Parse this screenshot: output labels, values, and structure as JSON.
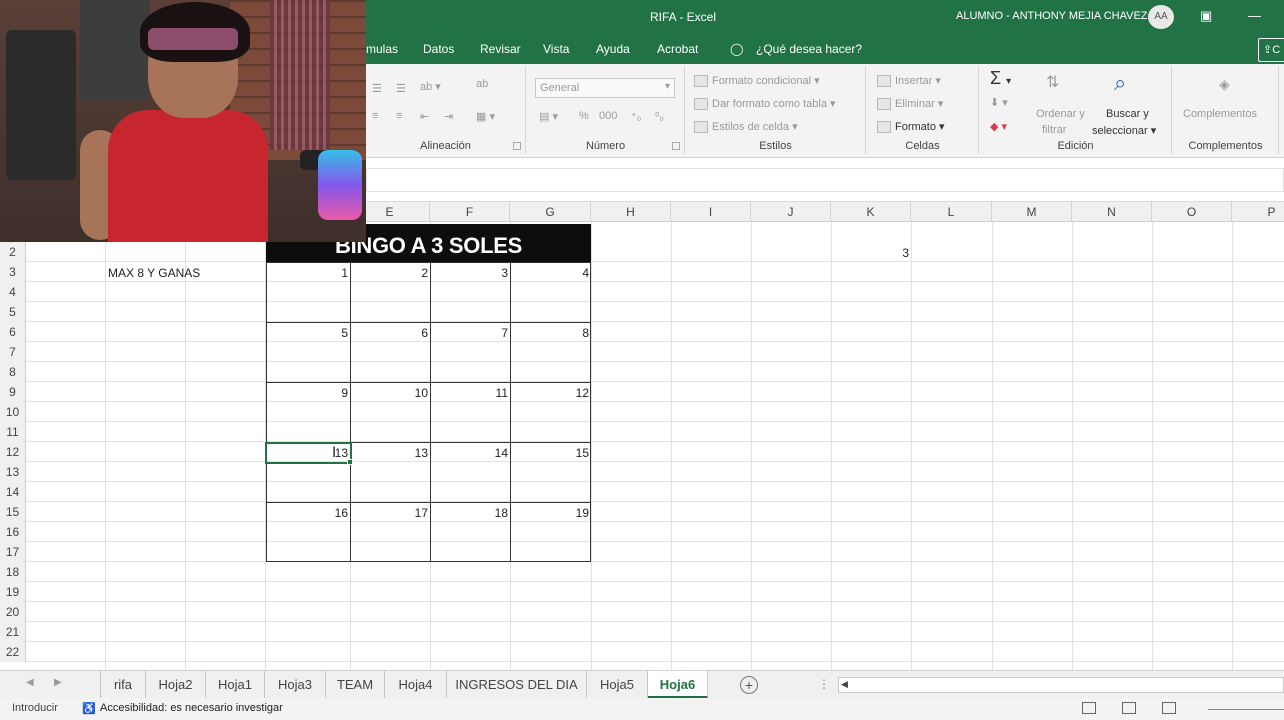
{
  "window": {
    "title": "RIFA  -  Excel",
    "user_name": "ALUMNO - ANTHONY MEJIA CHAVEZ",
    "user_initials": "AA"
  },
  "menu": {
    "formulas": "mulas",
    "datos": "Datos",
    "revisar": "Revisar",
    "vista": "Vista",
    "ayuda": "Ayuda",
    "acrobat": "Acrobat",
    "search": "¿Qué desea hacer?",
    "share": "C"
  },
  "ribbon": {
    "alineacion_label": "Alineación",
    "numero_label": "Número",
    "number_format": "General",
    "estilos_label": "Estilos",
    "formato_condicional": "Formato condicional",
    "dar_formato_tabla": "Dar formato como tabla",
    "estilos_celda": "Estilos de celda",
    "celdas_label": "Celdas",
    "insertar": "Insertar",
    "eliminar": "Eliminar",
    "formato": "Formato",
    "edicion_label": "Edición",
    "ordenar_filtrar_1": "Ordenar y",
    "ordenar_filtrar_2": "filtrar",
    "buscar_1": "Buscar y",
    "buscar_2": "seleccionar",
    "complementos_btn": "Complementos",
    "complementos_label": "Complementos",
    "sigma": "Σ",
    "percent": "%",
    "thousands": "000"
  },
  "columns": [
    "E",
    "F",
    "G",
    "H",
    "I",
    "J",
    "K",
    "L",
    "M",
    "N",
    "O",
    "P"
  ],
  "rows": [
    "2",
    "3",
    "4",
    "5",
    "6",
    "7",
    "8",
    "9",
    "10",
    "11",
    "12",
    "13",
    "14",
    "15",
    "16",
    "17",
    "18",
    "19",
    "20",
    "21",
    "22"
  ],
  "cells": {
    "bingo_title": "BINGO A 3 SOLES",
    "max_note": "MAX 8 Y GANAS",
    "k2_value": "3",
    "bingo_numbers": [
      [
        "1",
        "2",
        "3",
        "4"
      ],
      [
        "5",
        "6",
        "7",
        "8"
      ],
      [
        "9",
        "10",
        "11",
        "12"
      ],
      [
        "13",
        "13",
        "14",
        "15"
      ],
      [
        "16",
        "17",
        "18",
        "19"
      ]
    ]
  },
  "sheets": [
    "rifa",
    "Hoja2",
    "Hoja1",
    "Hoja3",
    "TEAM",
    "Hoja4",
    "INGRESOS DEL DIA",
    "Hoja5",
    "Hoja6"
  ],
  "active_sheet": "Hoja6",
  "status": {
    "mode": "Introducir",
    "accessibility": "Accesibilidad: es necesario investigar"
  }
}
